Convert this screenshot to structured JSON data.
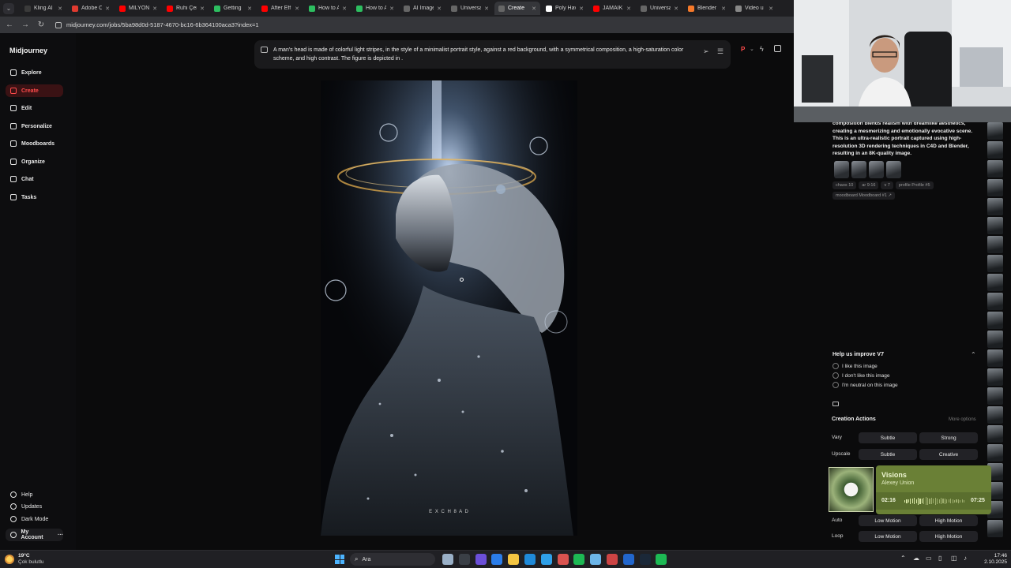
{
  "tabs": [
    {
      "title": "Kling AI |",
      "color": "#3a3a3a"
    },
    {
      "title": "Adobe C",
      "color": "#e03a2f"
    },
    {
      "title": "MİLYON",
      "color": "#ff0000"
    },
    {
      "title": "Ruhi Çen",
      "color": "#ff0000"
    },
    {
      "title": "Getting",
      "color": "#2dbe60"
    },
    {
      "title": "After Eff",
      "color": "#ff0000"
    },
    {
      "title": "How to A",
      "color": "#2dbe60"
    },
    {
      "title": "How to A",
      "color": "#2dbe60"
    },
    {
      "title": "AI Image",
      "color": "#666"
    },
    {
      "title": "Universa",
      "color": "#666"
    },
    {
      "title": "Create",
      "color": "#666",
      "active": true
    },
    {
      "title": "Poly Hav",
      "color": "#ffffff"
    },
    {
      "title": "JAMAİK",
      "color": "#ff0000"
    },
    {
      "title": "Universa",
      "color": "#666"
    },
    {
      "title": "Blender",
      "color": "#f5792a"
    },
    {
      "title": "Video u",
      "color": "#888"
    }
  ],
  "address": {
    "url": "midjourney.com/jobs/5ba98d0d-5187-4670-bc16-6b364100aca3?index=1"
  },
  "sidebar": {
    "brand": "Midjourney",
    "items": [
      {
        "label": "Explore",
        "icon": "compass-icon"
      },
      {
        "label": "Create",
        "icon": "brush-icon",
        "active": true
      },
      {
        "label": "Edit",
        "icon": "edit-icon"
      },
      {
        "label": "Personalize",
        "icon": "personalize-icon"
      },
      {
        "label": "Moodboards",
        "icon": "moodboard-icon"
      },
      {
        "label": "Organize",
        "icon": "grid-icon"
      },
      {
        "label": "Chat",
        "icon": "chat-icon"
      },
      {
        "label": "Tasks",
        "icon": "thumbs-up-icon"
      }
    ],
    "bottom": [
      {
        "label": "Help",
        "icon": "help-icon"
      },
      {
        "label": "Updates",
        "icon": "bell-icon"
      },
      {
        "label": "Dark Mode",
        "icon": "moon-icon"
      },
      {
        "label": "My Account",
        "icon": "account-icon"
      }
    ],
    "account_more": "···"
  },
  "prompt": {
    "text": "A man's head is made of colorful light stripes, in the style of a minimalist portrait style, against a red background, with a symmetrical composition, a high-saturation color scheme, and high contrast. The figure is depicted in ."
  },
  "image": {
    "watermark": "E X C H 8 A D"
  },
  "right_panel": {
    "description": "composition blends realism with dreamlike aesthetics, creating a mesmerizing and emotionally evocative scene. This is an ultra-realistic portrait captured using high-resolution 3D rendering techniques in C4D and Blender, resulting in an 8K-quality image.",
    "chips": [
      "chaos 10",
      "ar 9:16",
      "v 7",
      "profile Profile #5",
      "moodboard Moodboard #1 ↗"
    ],
    "help_title": "Help us improve V7",
    "feedback": [
      "I like this image",
      "I don't like this image",
      "I'm neutral on this image"
    ],
    "actions_title": "Creation Actions",
    "more_options": "More options",
    "rows": [
      {
        "label": "Vary",
        "buttons": [
          "Subtle",
          "Strong"
        ]
      },
      {
        "label": "Upscale",
        "buttons": [
          "Subtle",
          "Creative"
        ]
      },
      {
        "label": "Auto",
        "buttons": [
          "Low Motion",
          "High Motion"
        ]
      },
      {
        "label": "Loop",
        "buttons": [
          "Low Motion",
          "High Motion"
        ]
      }
    ]
  },
  "music": {
    "song": "Visions",
    "artist": "Alexey Union",
    "elapsed": "02:16",
    "total": "07:25",
    "progress": 0.31
  },
  "taskbar": {
    "temp": "19°C",
    "weather": "Çok bulutlu",
    "search_placeholder": "Ara",
    "time": "17:46",
    "date": "2.10.2025"
  },
  "colors": {
    "accent": "#ff4b4b",
    "music_card": "#6a8036"
  }
}
